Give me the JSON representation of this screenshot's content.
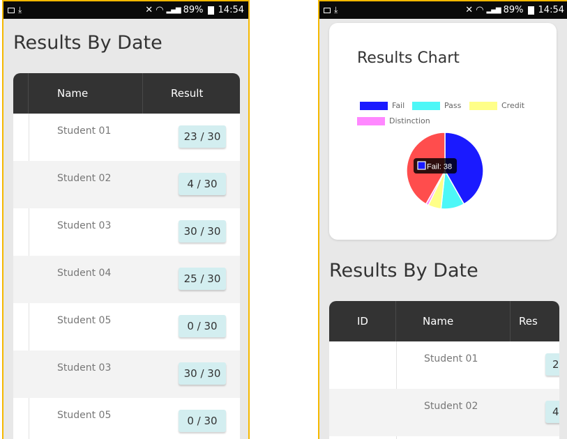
{
  "status_bar": {
    "battery": "89%",
    "time": "14:54"
  },
  "left": {
    "title": "Results By Date",
    "columns": {
      "name": "Name",
      "result": "Result"
    },
    "rows": [
      {
        "name": "Student 01",
        "result": "23 / 30"
      },
      {
        "name": "Student 02",
        "result": "4 / 30"
      },
      {
        "name": "Student 03",
        "result": "30 / 30"
      },
      {
        "name": "Student 04",
        "result": "25 / 30"
      },
      {
        "name": "Student 05",
        "result": "0 / 30"
      },
      {
        "name": "Student 03",
        "result": "30 / 30"
      },
      {
        "name": "Student 05",
        "result": "0 / 30"
      }
    ]
  },
  "right": {
    "chart_title": "Results Chart",
    "tooltip": "Fail: 38",
    "title": "Results By Date",
    "columns": {
      "id": "ID",
      "name": "Name",
      "result": "Res"
    },
    "rows": [
      {
        "name": "Student 01",
        "result": "2"
      },
      {
        "name": "Student 02",
        "result": "4"
      }
    ]
  },
  "chart_data": {
    "type": "pie",
    "title": "Results Chart",
    "legend_position": "top",
    "categories": [
      "Fail",
      "Pass",
      "Credit",
      "Distinction"
    ],
    "values": [
      38,
      9,
      5,
      1
    ],
    "colors": [
      "#1a1aff",
      "#4df7f7",
      "#ffff88",
      "#ff88ff"
    ],
    "remainder_color": "#ff4d4d",
    "remainder_value": 38
  }
}
